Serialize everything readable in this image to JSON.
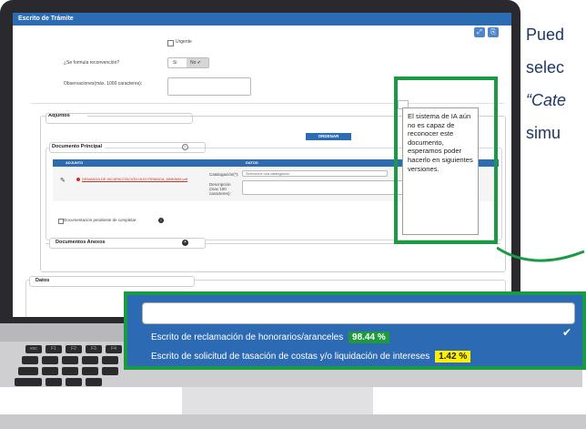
{
  "window": {
    "title": "Escrito de Trámite"
  },
  "toolbar": {
    "icon1": "⤢",
    "icon2": "⎘"
  },
  "form": {
    "urgente_label": "Urgente",
    "reconvencion_label": "¿Se formula reconvención?",
    "si_label": "Si",
    "no_label": "No ✔",
    "observaciones_label": "Observaciones(máx. 1000 caracteres):",
    "observaciones_value": ""
  },
  "adjuntos": {
    "title": "Adjuntos",
    "ordenar_label": "ORDENAR",
    "tooltip_text": "El sistema de IA aún no es capaz de reconocer este documento, esperamos poder hacerlo en siguientes versiones."
  },
  "documento_principal": {
    "title": "Documento Principal",
    "col_adjunto": "ADJUNTO",
    "col_datos": "DATOS",
    "file_name": "DEMANDA DE INCAPACITACIÓN HIJO PIRMADA_MMMMM.pdf",
    "catalogacion_label": "Catalogación(*):",
    "catalogacion_placeholder": "Seleccione una catalogación",
    "descripcion_label": "Descripción (max 100 caracteres):",
    "pendiente_label": "Documentación pendiente de completar"
  },
  "documentos_anexos": {
    "title": "Documentos Anexos"
  },
  "datos": {
    "title": "Datos"
  },
  "suggestions": {
    "input_value": "",
    "items": [
      {
        "label": "Escrito de reclamación de honorarios/aranceles",
        "score": "98.44 %",
        "color": "#1e9a3c",
        "text_color": "#ffffff"
      },
      {
        "label": "Escrito de solicitud de tasación de costas y/o liquidación de intereses",
        "score": "1.42 %",
        "color": "#fff000",
        "text_color": "#222222"
      }
    ]
  },
  "side_text": {
    "line1": "Pued",
    "line2": "selec",
    "line3": "“Cate",
    "line4": "simu"
  },
  "keyboard": {
    "keys": [
      "esc",
      "F1",
      "F2",
      "F3",
      "F4",
      "F5",
      "F6"
    ]
  }
}
